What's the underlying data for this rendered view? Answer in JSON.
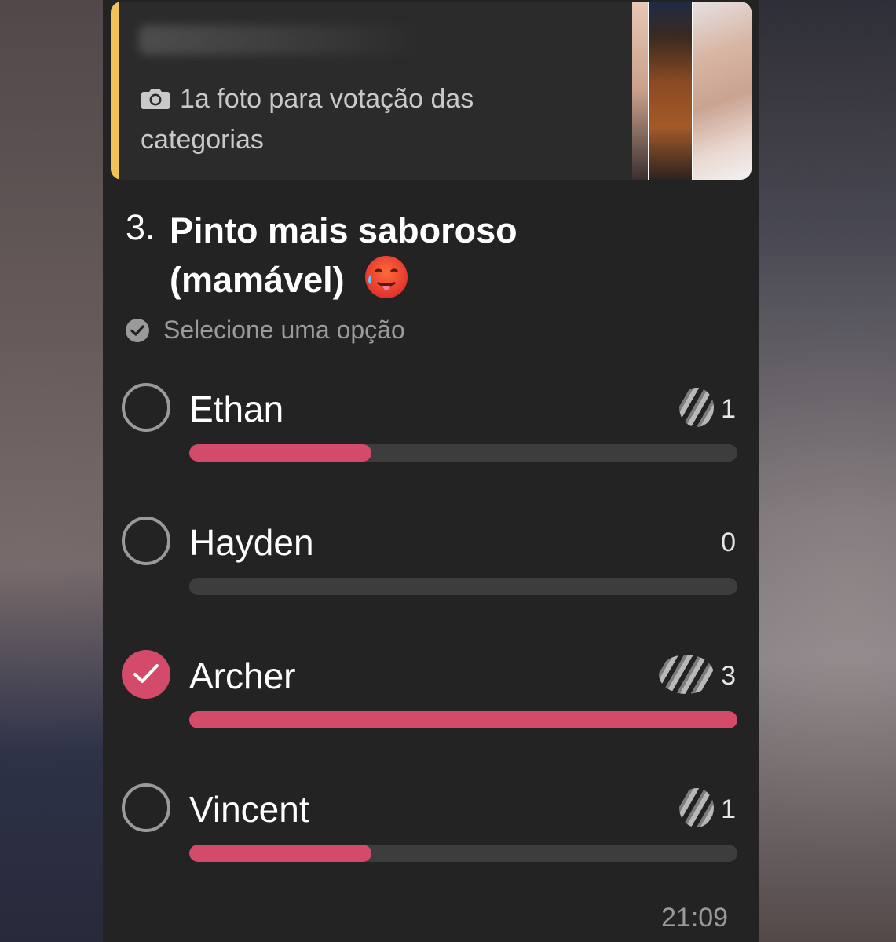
{
  "quoted_message": {
    "text": "1a foto para votação das categorias",
    "media_icon": "camera-icon",
    "accent_color": "#f2c25a"
  },
  "poll": {
    "number": "3.",
    "question": "Pinto mais saboroso (mamável)",
    "emoji": "hot-face-emoji",
    "hint": "Selecione uma opção",
    "accent_color": "#d34a6b",
    "options": [
      {
        "label": "Ethan",
        "votes": "1",
        "fraction": 0.333,
        "checked": false
      },
      {
        "label": "Hayden",
        "votes": "0",
        "fraction": 0,
        "checked": false
      },
      {
        "label": "Archer",
        "votes": "3",
        "fraction": 1.0,
        "checked": true
      },
      {
        "label": "Vincent",
        "votes": "1",
        "fraction": 0.333,
        "checked": false
      }
    ]
  },
  "timestamp": "21:09"
}
